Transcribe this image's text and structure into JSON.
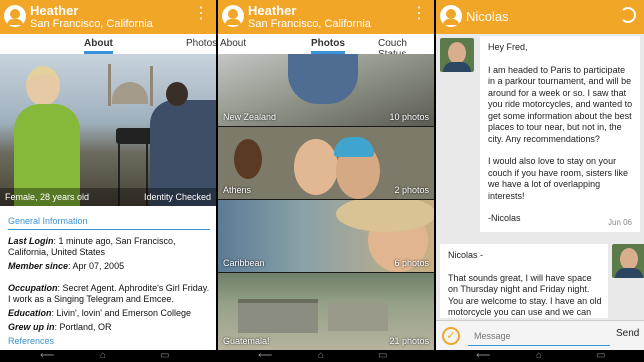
{
  "panel_about": {
    "header": {
      "name": "Heather",
      "location": "San Francisco, California"
    },
    "tabs": {
      "about": "About",
      "photos": "Photos"
    },
    "hero": {
      "gender_age": "Female,  28  years old",
      "identity": "Identity Checked"
    },
    "info": {
      "section_title": "General Information",
      "rows": [
        {
          "label": "Last Login",
          "value": ": 1 minute ago, San Francisco, California, United States"
        },
        {
          "label": "Member since",
          "value": ": Apr 07, 2005"
        },
        {
          "label": "Occupation",
          "value": ": Secret Agent. Aphrodite's Girl Friday. I work as a Singing Telegram and Emcee."
        },
        {
          "label": "Education",
          "value": ": Livin', lovin' and Emerson College"
        },
        {
          "label": "Grew up in",
          "value": ": Portland, OR"
        }
      ],
      "next_section": "References"
    }
  },
  "panel_photos": {
    "header": {
      "name": "Heather",
      "location": "San Francisco, California"
    },
    "tabs": {
      "about": "About",
      "photos": "Photos",
      "couch": "Couch Status"
    },
    "albums": [
      {
        "name": "New Zealand",
        "count": "10 photos"
      },
      {
        "name": "Athens",
        "count": "2 photos"
      },
      {
        "name": "Caribbean",
        "count": "6 photos"
      },
      {
        "name": "Guatemala!",
        "count": "21 photos"
      }
    ]
  },
  "panel_messages": {
    "header": {
      "name": "Nicolas"
    },
    "message1": {
      "p1": "Hey Fred,",
      "p2": "I am headed to Paris to participate in a parkour tournament, and will be around for a week or so. I saw that you ride motorcycles, and wanted to get some information about the best places to tour near, but not in, the city. Any recommendations?",
      "p3": "I would also love to stay on your couch if you have room, sisters like we have a lot of overlapping interests!",
      "p4": "-Nicolas",
      "date": "Jun 06"
    },
    "message2": {
      "p1": "Nicolas -",
      "p2": "That sounds great, I will have space on Thursday night and Friday night. You are welcome to stay. I have an old motorcycle you can use and we can go out for a ride on Saturday morning if"
    },
    "compose": {
      "placeholder": "Message",
      "send": "Send"
    }
  },
  "icons": {
    "profile": "person-icon",
    "overflow": "overflow-menu-icon",
    "refresh": "refresh-icon",
    "check": "check-icon",
    "back": "back-icon",
    "home": "home-icon",
    "recents": "recents-icon"
  },
  "colors": {
    "action_bar": "#f2a628",
    "accent": "#3a93d6"
  }
}
